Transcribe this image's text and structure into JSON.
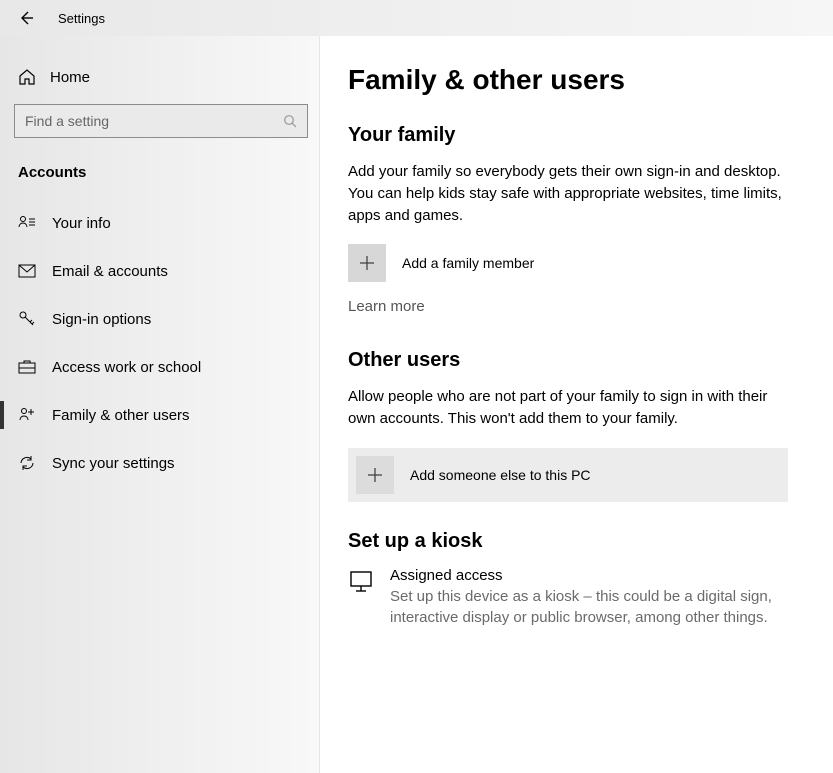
{
  "window": {
    "title": "Settings"
  },
  "sidebar": {
    "home": "Home",
    "search_placeholder": "Find a setting",
    "section": "Accounts",
    "items": [
      {
        "label": "Your info"
      },
      {
        "label": "Email & accounts"
      },
      {
        "label": "Sign-in options"
      },
      {
        "label": "Access work or school"
      },
      {
        "label": "Family & other users"
      },
      {
        "label": "Sync your settings"
      }
    ]
  },
  "main": {
    "title": "Family & other users",
    "family_heading": "Your family",
    "family_desc": "Add your family so everybody gets their own sign-in and desktop. You can help kids stay safe with appropriate websites, time limits, apps and games.",
    "add_family": "Add a family member",
    "learn_more": "Learn more",
    "other_heading": "Other users",
    "other_desc": "Allow people who are not part of your family to sign in with their own accounts. This won't add them to your family.",
    "add_other": "Add someone else to this PC",
    "kiosk_heading": "Set up a kiosk",
    "kiosk_title": "Assigned access",
    "kiosk_desc": "Set up this device as a kiosk – this could be a digital sign, interactive display or public browser, among other things."
  }
}
